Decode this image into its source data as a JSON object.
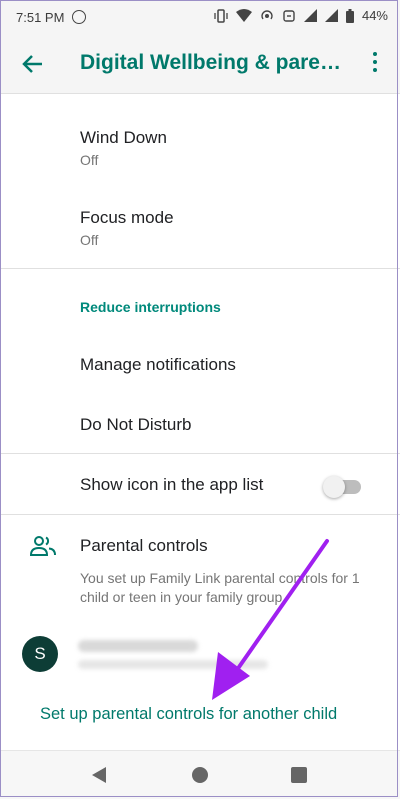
{
  "status_bar": {
    "time": "7:51 PM",
    "battery": "44%",
    "icons": [
      "whatsapp-icon",
      "vibrate-icon",
      "wifi-icon",
      "hotspot-icon",
      "data-saver-icon",
      "signal-icon",
      "signal-icon",
      "battery-icon"
    ]
  },
  "app_bar": {
    "title": "Digital Wellbeing & parental controls",
    "back_icon": "arrow-back-icon",
    "menu_icon": "more-vert-icon"
  },
  "settings": {
    "wind_down": {
      "title": "Wind Down",
      "subtitle": "Off"
    },
    "focus_mode": {
      "title": "Focus mode",
      "subtitle": "Off"
    },
    "section_header": "Reduce interruptions",
    "manage_notifications": "Manage notifications",
    "do_not_disturb": "Do Not Disturb",
    "show_icon": {
      "title": "Show icon in the app list",
      "enabled": false
    }
  },
  "parental": {
    "icon": "people-icon",
    "title": "Parental controls",
    "description": "You set up Family Link parental controls for 1 child or teen in your family group",
    "child_avatar_letter": "S",
    "setup_link": "Set up parental controls for another child"
  },
  "annotation": {
    "color": "#a020f0"
  },
  "nav_bar": {
    "icons": [
      "back-triangle-icon",
      "home-circle-icon",
      "recents-square-icon"
    ]
  },
  "colors": {
    "accent": "#00796b",
    "section": "#00897b",
    "avatar": "#0d3d36"
  }
}
